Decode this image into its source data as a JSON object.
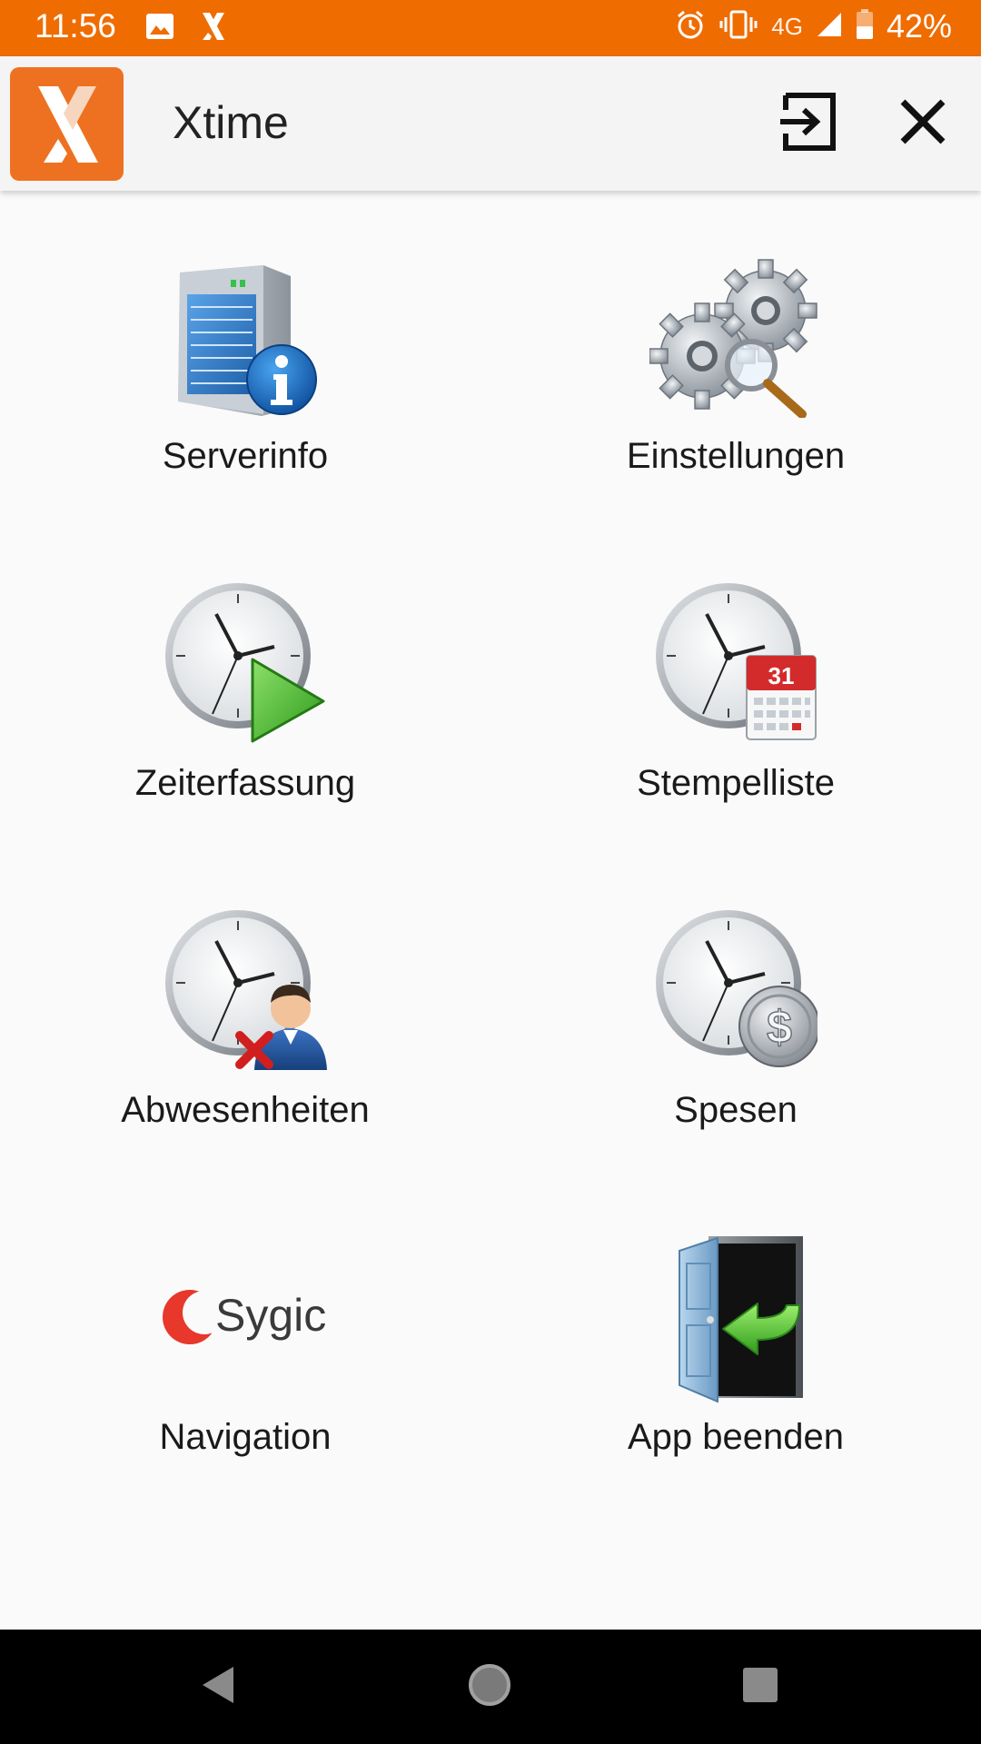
{
  "status_bar": {
    "time": "11:56",
    "network": "4G",
    "battery": "42%",
    "icons": [
      "image-icon",
      "xtime-notification-icon",
      "alarm-icon",
      "vibrate-icon",
      "signal-icon",
      "battery-icon"
    ]
  },
  "app_bar": {
    "title": "Xtime",
    "actions": [
      "login-icon",
      "close-icon"
    ]
  },
  "menu": {
    "items": [
      {
        "label": "Serverinfo",
        "icon": "server-info-icon"
      },
      {
        "label": "Einstellungen",
        "icon": "settings-gears-icon"
      },
      {
        "label": "Zeiterfassung",
        "icon": "clock-play-icon"
      },
      {
        "label": "Stempelliste",
        "icon": "clock-calendar-icon"
      },
      {
        "label": "Abwesenheiten",
        "icon": "clock-absence-icon"
      },
      {
        "label": "Spesen",
        "icon": "clock-dollar-icon"
      },
      {
        "label": "Navigation",
        "icon": "sygic-logo"
      },
      {
        "label": "App beenden",
        "icon": "exit-door-icon"
      }
    ],
    "calendar_day": "31",
    "sygic_brand": "Sygic"
  },
  "colors": {
    "accent": "#ef6c00",
    "logo": "#ee7121",
    "background": "#fafafa"
  }
}
